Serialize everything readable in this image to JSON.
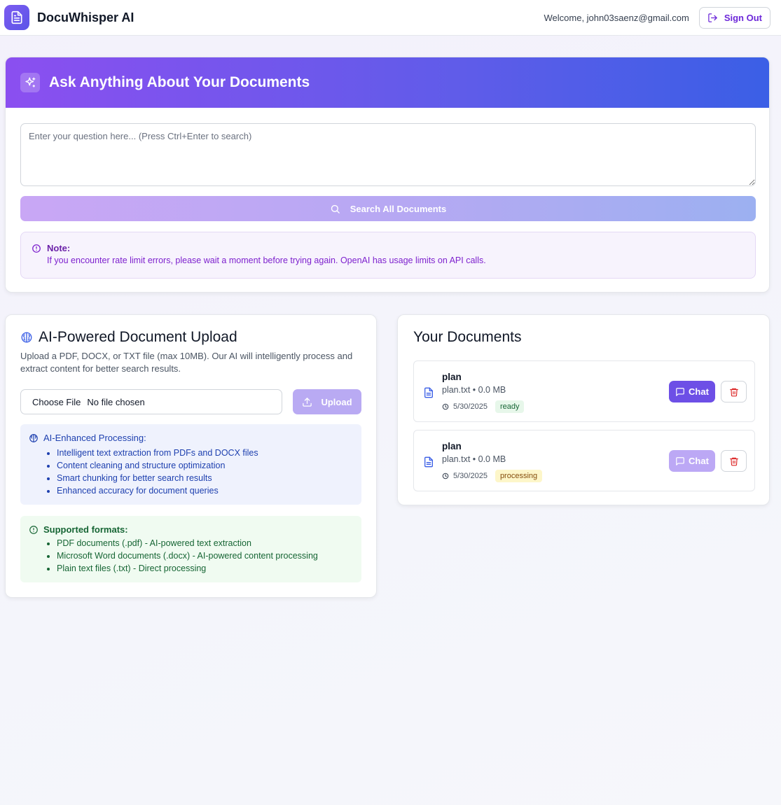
{
  "header": {
    "app_name": "DocuWhisper AI",
    "welcome": "Welcome, john03saenz@gmail.com",
    "signout_label": "Sign Out"
  },
  "ask": {
    "title": "Ask Anything About Your Documents",
    "placeholder": "Enter your question here... (Press Ctrl+Enter to search)",
    "search_label": "Search All Documents",
    "note_title": "Note:",
    "note_text": "If you encounter rate limit errors, please wait a moment before trying again. OpenAI has usage limits on API calls."
  },
  "upload": {
    "title": "AI-Powered Document Upload",
    "description": "Upload a PDF, DOCX, or TXT file (max 10MB). Our AI will intelligently process and extract content for better search results.",
    "choose_label": "Choose File",
    "no_file_label": "No file chosen",
    "upload_label": "Upload",
    "ai_title": "AI-Enhanced Processing:",
    "ai_items": [
      "Intelligent text extraction from PDFs and DOCX files",
      "Content cleaning and structure optimization",
      "Smart chunking for better search results",
      "Enhanced accuracy for document queries"
    ],
    "formats_title": "Supported formats:",
    "formats_items": [
      "PDF documents (.pdf) - AI-powered text extraction",
      "Microsoft Word documents (.docx) - AI-powered content processing",
      "Plain text files (.txt) - Direct processing"
    ]
  },
  "documents": {
    "title": "Your Documents",
    "items": [
      {
        "name": "plan",
        "meta": "plan.txt • 0.0 MB",
        "date": "5/30/2025",
        "status": "ready",
        "chat_label": "Chat"
      },
      {
        "name": "plan",
        "meta": "plan.txt • 0.0 MB",
        "date": "5/30/2025",
        "status": "processing",
        "chat_label": "Chat"
      }
    ]
  },
  "colors": {
    "accent": "#6d4fe6",
    "gradient_start": "#8b4ff0",
    "gradient_end": "#3b5fe6",
    "ready_badge": "#e7f7ea",
    "processing_badge": "#fdf6c9"
  }
}
